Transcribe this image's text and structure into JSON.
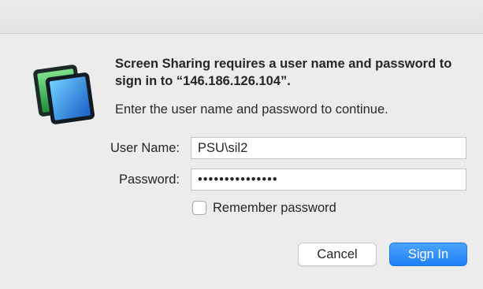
{
  "dialog": {
    "title": "Screen Sharing requires a user name and password to sign in to “146.186.126.104”.",
    "subtitle": "Enter the user name and password to continue.",
    "app_icon": "screen-sharing-icon"
  },
  "form": {
    "username_label": "User Name:",
    "username_value": "PSU\\sil2",
    "password_label": "Password:",
    "password_value": "•••••••••••••••",
    "remember_label": "Remember password",
    "remember_checked": false
  },
  "buttons": {
    "cancel_label": "Cancel",
    "signin_label": "Sign In"
  },
  "colors": {
    "accent": "#1f82f6",
    "background": "#ececec"
  }
}
